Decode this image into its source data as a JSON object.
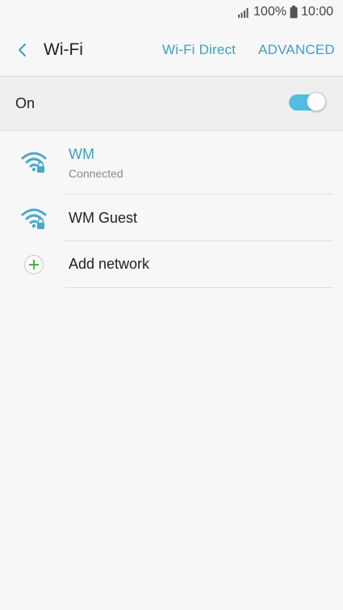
{
  "status_bar": {
    "battery": "100%",
    "time": "10:00",
    "signal_icon": "signal-icon",
    "battery_icon": "battery-icon"
  },
  "app_bar": {
    "title": "Wi-Fi",
    "back_icon": "back-arrow-icon",
    "actions": [
      "Wi-Fi Direct",
      "ADVANCED"
    ]
  },
  "master_switch": {
    "label": "On",
    "enabled": true
  },
  "networks": [
    {
      "name": "WM",
      "status": "Connected",
      "secured": true,
      "connected": true
    },
    {
      "name": "WM Guest",
      "status": "",
      "secured": true,
      "connected": false
    }
  ],
  "add_network": {
    "label": "Add network",
    "icon": "plus-icon"
  },
  "colors": {
    "accent": "#3f9fbf",
    "toggle_on": "#52bde3",
    "add_plus": "#3dbb3d"
  }
}
